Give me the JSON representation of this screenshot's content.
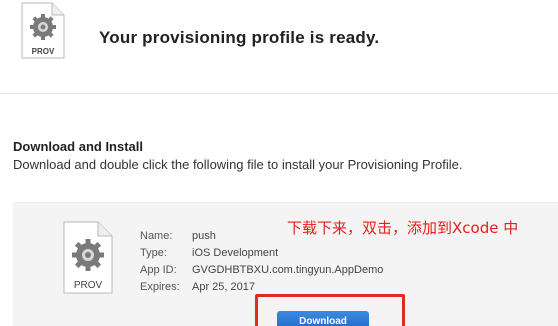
{
  "header": {
    "icon_name": "prov-file-icon",
    "icon_label": "PROV",
    "title": "Your provisioning profile is ready."
  },
  "section": {
    "title": "Download and Install",
    "description": "Download and double click the following file to install your Provisioning Profile."
  },
  "panel": {
    "icon_name": "prov-file-icon",
    "icon_label": "PROV",
    "details": [
      {
        "label": "Name:",
        "value": "push"
      },
      {
        "label": "Type:",
        "value": "iOS Development"
      },
      {
        "label": "App ID:",
        "value": "GVGDHBTBXU.com.tingyun.AppDemo"
      },
      {
        "label": "Expires:",
        "value": "Apr 25, 2017"
      }
    ],
    "annotation": "下载下来，双击，添加到Xcode 中",
    "download_label": "Download"
  },
  "colors": {
    "annotation": "#e8201a",
    "highlight_box": "#e22a1f",
    "button": "#2a74d4",
    "panel_bg": "#f4f4f4"
  }
}
